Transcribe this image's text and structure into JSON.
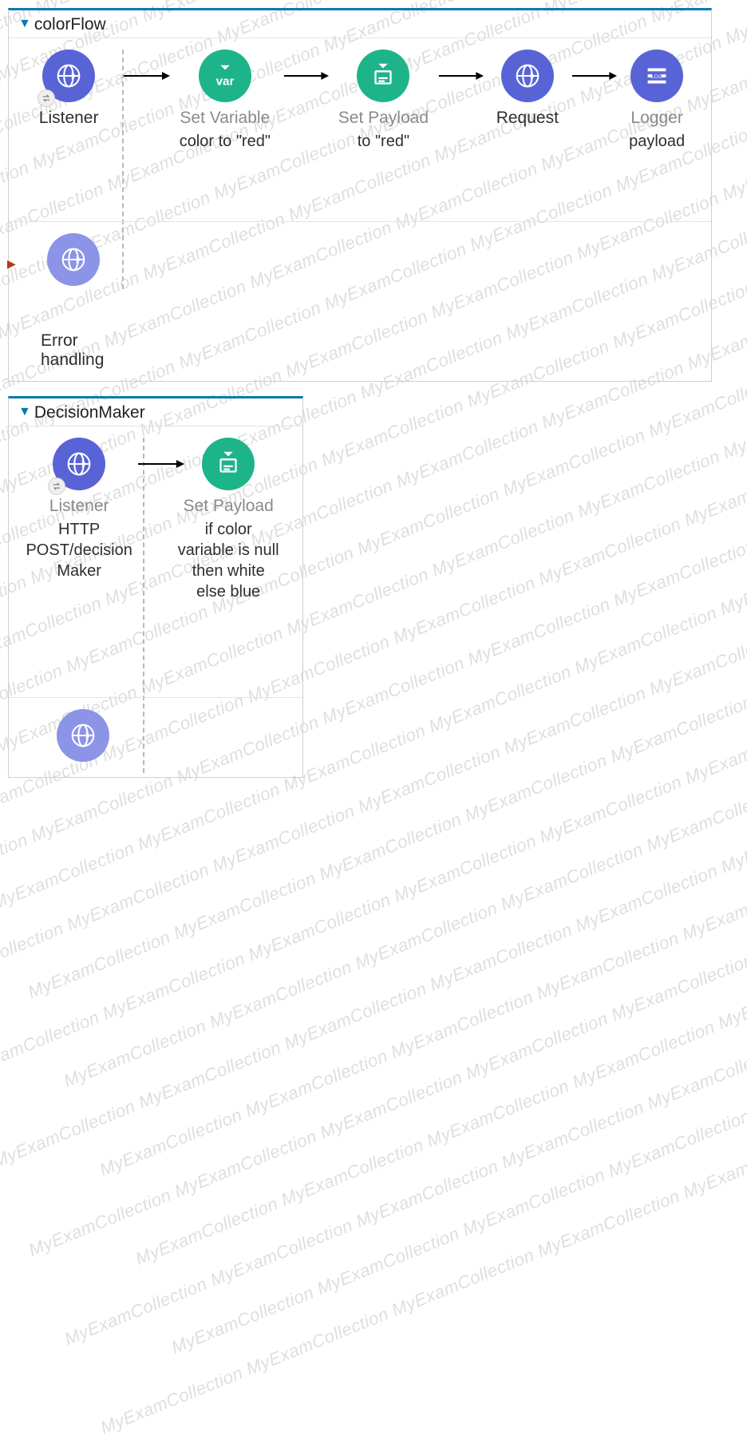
{
  "watermark": "MyExamCollection ",
  "flows": {
    "colorFlow": {
      "title": "colorFlow",
      "nodes": {
        "listener": {
          "label": "Listener"
        },
        "setVar": {
          "label": "Set Variable",
          "sub": "color to \"red\""
        },
        "setPay": {
          "label": "Set Payload",
          "sub": "to \"red\""
        },
        "request": {
          "label": "Request"
        },
        "logger": {
          "label": "Logger",
          "sub": "payload"
        }
      },
      "error_label": "Error handling"
    },
    "decisionMaker": {
      "title": "DecisionMaker",
      "nodes": {
        "listener": {
          "label": "Listener",
          "sub": "HTTP POST/decisionMaker"
        },
        "setPay": {
          "label": "Set Payload",
          "sub": "if color variable is null then white else blue"
        }
      }
    }
  }
}
